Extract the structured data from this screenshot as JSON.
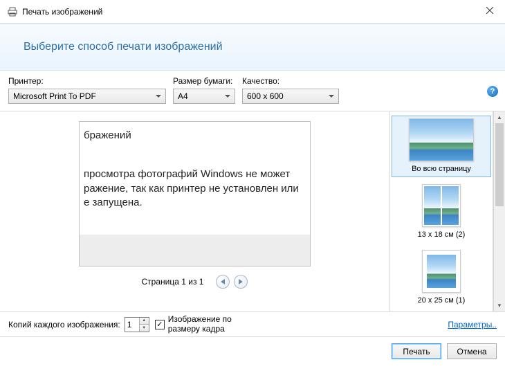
{
  "window": {
    "title": "Печать изображений",
    "banner": "Выберите способ печати изображений"
  },
  "controls": {
    "printer_label": "Принтер:",
    "printer_value": "Microsoft Print To PDF",
    "paper_label": "Размер бумаги:",
    "paper_value": "A4",
    "quality_label": "Качество:",
    "quality_value": "600 x 600",
    "help_symbol": "?"
  },
  "preview": {
    "title_fragment": "бражений",
    "body_line1": "просмотра фотографий Windows не может",
    "body_line2": "ражение, так как принтер не установлен или",
    "body_line3": "е запущена.",
    "page_indicator": "Страница 1 из 1"
  },
  "layouts": [
    {
      "label": "Во всю страницу",
      "selected": true,
      "thumb": "full"
    },
    {
      "label": "13 x 18 см (2)",
      "selected": false,
      "thumb": "two"
    },
    {
      "label": "20 x 25 см (1)",
      "selected": false,
      "thumb": "one"
    }
  ],
  "bottom": {
    "copies_label": "Копий каждого изображения:",
    "copies_value": "1",
    "fit_checked": true,
    "fit_label": "Изображение по размеру кадра",
    "params_link": "Параметры..",
    "print_btn": "Печать",
    "cancel_btn": "Отмена"
  }
}
